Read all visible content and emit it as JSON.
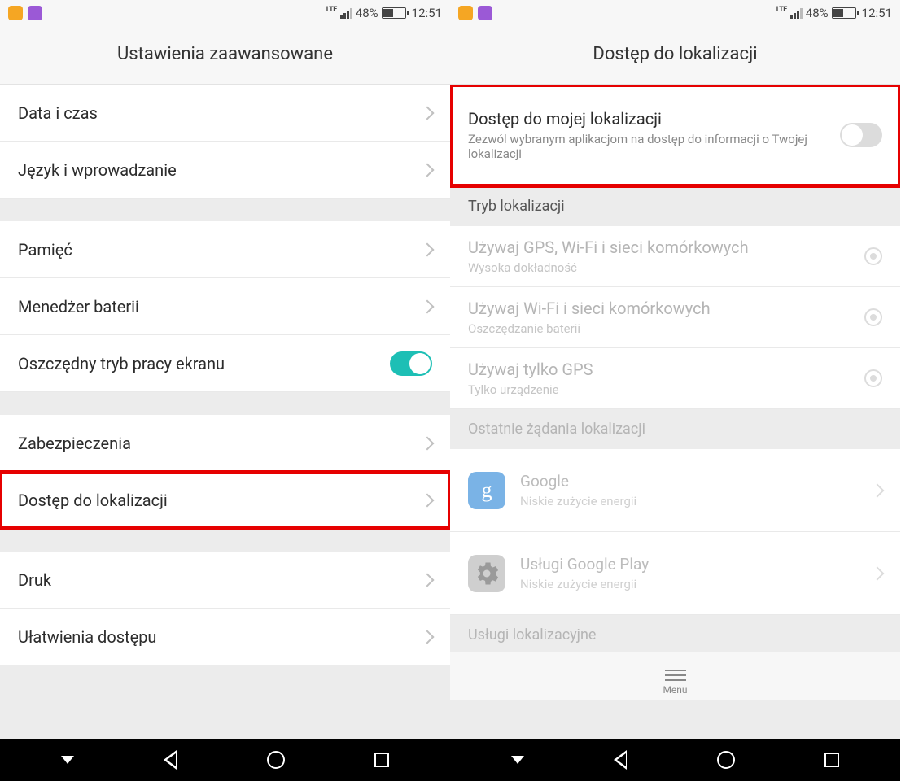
{
  "status": {
    "battery": "48%",
    "time": "12:51",
    "net": "LTE"
  },
  "left": {
    "title": "Ustawienia zaawansowane",
    "items": {
      "date_time": "Data i czas",
      "language": "Język i wprowadzanie",
      "memory": "Pamięć",
      "battery": "Menedżer baterii",
      "screen_save": "Oszczędny tryb pracy ekranu",
      "security": "Zabezpieczenia",
      "location": "Dostęp do lokalizacji",
      "print": "Druk",
      "accessibility": "Ułatwienia dostępu"
    }
  },
  "right": {
    "title": "Dostęp do lokalizacji",
    "access": {
      "title": "Dostęp do mojej lokalizacji",
      "desc": "Zezwól wybranym aplikacjom na dostęp do informacji o Twojej lokalizacji"
    },
    "mode_header": "Tryb lokalizacji",
    "modes": {
      "gps_wifi": {
        "t": "Używaj GPS, Wi-Fi i sieci komórkowych",
        "s": "Wysoka dokładność"
      },
      "wifi": {
        "t": "Używaj Wi-Fi i sieci komórkowych",
        "s": "Oszczędzanie baterii"
      },
      "gps": {
        "t": "Używaj tylko GPS",
        "s": "Tylko urządzenie"
      }
    },
    "recent_header": "Ostatnie żądania lokalizacji",
    "apps": {
      "google": {
        "t": "Google",
        "s": "Niskie zużycie energii"
      },
      "play": {
        "t": "Usługi Google Play",
        "s": "Niskie zużycie energii"
      }
    },
    "services_header": "Usługi lokalizacyjne",
    "menu": "Menu"
  }
}
